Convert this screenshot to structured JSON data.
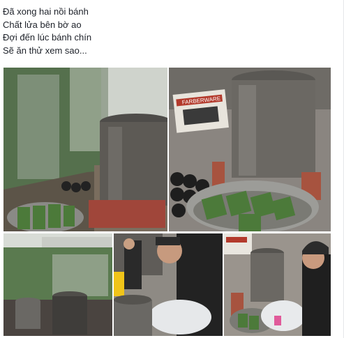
{
  "post": {
    "caption_lines": [
      "Đã xong hai nồi bánh",
      "Chất lửa bên bờ ao",
      "Đợi đến lúc bánh chín",
      "Sẽ ăn thử xem sao..."
    ]
  },
  "photos": [
    {
      "name": "photo-pot-by-lake",
      "subject": "cooking pot on fire beside lake"
    },
    {
      "name": "photo-pot-and-boxes",
      "subject": "pot with coal and Farberware box"
    },
    {
      "name": "photo-lake-view",
      "subject": "lake with two pots"
    },
    {
      "name": "photo-man-washing",
      "subject": "man at wash basin beside pot"
    },
    {
      "name": "photo-boy-washing",
      "subject": "boy washing at basin beside pot"
    }
  ],
  "box_label": "FARBERWARE",
  "colors": {
    "text": "#1d2129",
    "pot": "#5d5a55",
    "water": "#4f6a4a",
    "leaf": "#4c7a3a"
  }
}
